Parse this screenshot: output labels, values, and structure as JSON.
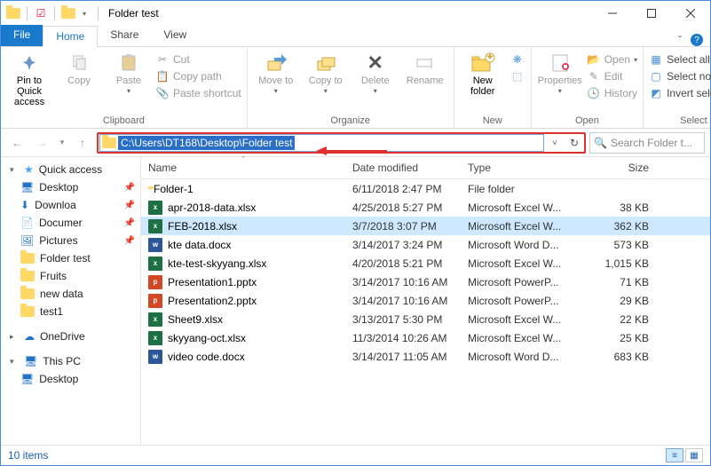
{
  "window": {
    "title": "Folder test"
  },
  "tabs": {
    "file": "File",
    "home": "Home",
    "share": "Share",
    "view": "View"
  },
  "ribbon": {
    "clipboard": {
      "label": "Clipboard",
      "pin": "Pin to Quick access",
      "copy": "Copy",
      "paste": "Paste",
      "cut": "Cut",
      "copypath": "Copy path",
      "pasteshortcut": "Paste shortcut"
    },
    "organize": {
      "label": "Organize",
      "moveto": "Move to",
      "copyto": "Copy to",
      "delete": "Delete",
      "rename": "Rename"
    },
    "new": {
      "label": "New",
      "newfolder": "New folder"
    },
    "open": {
      "label": "Open",
      "properties": "Properties",
      "open": "Open",
      "edit": "Edit",
      "history": "History"
    },
    "select": {
      "label": "Select",
      "selectall": "Select all",
      "selectnone": "Select none",
      "invert": "Invert selection"
    }
  },
  "address": {
    "path": "C:\\Users\\DT168\\Desktop\\Folder test",
    "search_placeholder": "Search Folder t..."
  },
  "sidebar": {
    "quick": "Quick access",
    "items": [
      "Desktop",
      "Downloa",
      "Documer",
      "Pictures",
      "Folder test",
      "Fruits",
      "new data",
      "test1"
    ],
    "onedrive": "OneDrive",
    "thispc": "This PC",
    "desktop2": "Desktop"
  },
  "columns": {
    "name": "Name",
    "date": "Date modified",
    "type": "Type",
    "size": "Size"
  },
  "files": [
    {
      "icon": "fold",
      "name": "Folder-1",
      "date": "6/11/2018 2:47 PM",
      "type": "File folder",
      "size": ""
    },
    {
      "icon": "xl",
      "name": "apr-2018-data.xlsx",
      "date": "4/25/2018 5:27 PM",
      "type": "Microsoft Excel W...",
      "size": "38 KB"
    },
    {
      "icon": "xl",
      "name": "FEB-2018.xlsx",
      "date": "3/7/2018 3:07 PM",
      "type": "Microsoft Excel W...",
      "size": "362 KB",
      "selected": true
    },
    {
      "icon": "doc",
      "name": "kte data.docx",
      "date": "3/14/2017 3:24 PM",
      "type": "Microsoft Word D...",
      "size": "573 KB"
    },
    {
      "icon": "xl",
      "name": "kte-test-skyyang.xlsx",
      "date": "4/20/2018 5:21 PM",
      "type": "Microsoft Excel W...",
      "size": "1,015 KB"
    },
    {
      "icon": "ppt",
      "name": "Presentation1.pptx",
      "date": "3/14/2017 10:16 AM",
      "type": "Microsoft PowerP...",
      "size": "71 KB"
    },
    {
      "icon": "ppt",
      "name": "Presentation2.pptx",
      "date": "3/14/2017 10:16 AM",
      "type": "Microsoft PowerP...",
      "size": "29 KB"
    },
    {
      "icon": "xl",
      "name": "Sheet9.xlsx",
      "date": "3/13/2017 5:30 PM",
      "type": "Microsoft Excel W...",
      "size": "22 KB"
    },
    {
      "icon": "xl",
      "name": "skyyang-oct.xlsx",
      "date": "11/3/2014 10:26 AM",
      "type": "Microsoft Excel W...",
      "size": "25 KB"
    },
    {
      "icon": "doc",
      "name": "video code.docx",
      "date": "3/14/2017 11:05 AM",
      "type": "Microsoft Word D...",
      "size": "683 KB"
    }
  ],
  "status": {
    "count": "10 items"
  }
}
